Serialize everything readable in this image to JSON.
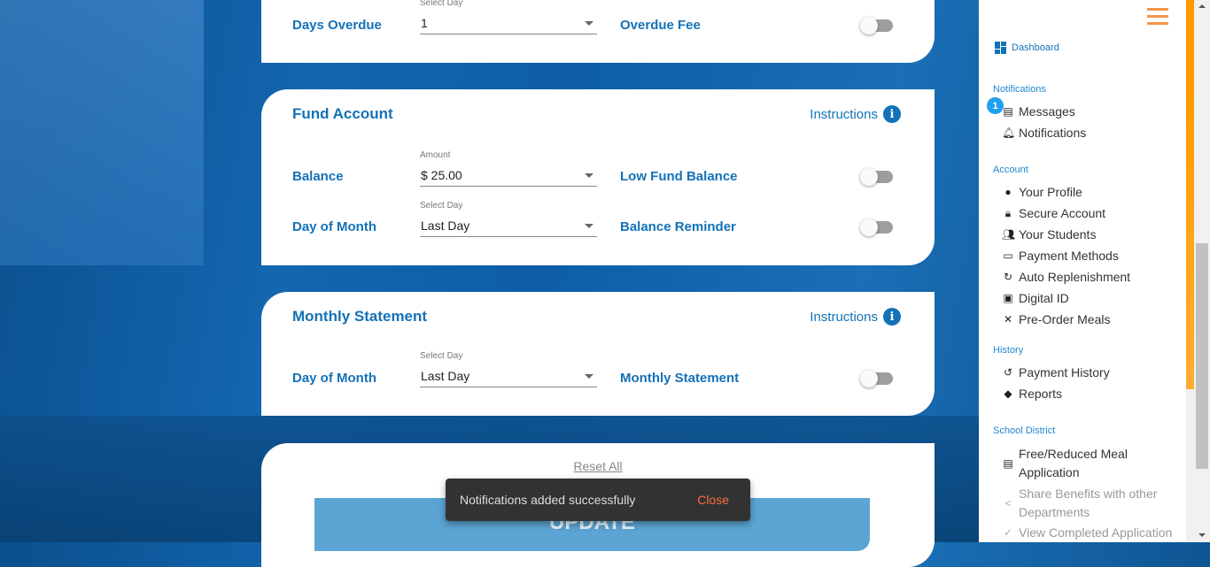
{
  "overdue": {
    "label": "Days Overdue",
    "select_caption": "Select Day",
    "select_value": "1",
    "toggle_label": "Overdue Fee",
    "toggle_on": false
  },
  "fund": {
    "title": "Fund Account",
    "instructions": "Instructions",
    "balance_label": "Balance",
    "amount_caption": "Amount",
    "amount_value": "$ 25.00",
    "low_fund_label": "Low Fund Balance",
    "low_fund_on": false,
    "dom_label": "Day of Month",
    "dom_caption": "Select Day",
    "dom_value": "Last Day",
    "reminder_label": "Balance Reminder",
    "reminder_on": false
  },
  "monthly": {
    "title": "Monthly Statement",
    "instructions": "Instructions",
    "dom_label": "Day of Month",
    "dom_caption": "Select Day",
    "dom_value": "Last Day",
    "toggle_label": "Monthly Statement",
    "toggle_on": false
  },
  "actions": {
    "reset": "Reset All",
    "update": "UPDATE"
  },
  "toast": {
    "message": "Notifications added successfully",
    "close": "Close"
  },
  "sidebar": {
    "dashboard": "Dashboard",
    "notifications_header": "Notifications",
    "messages": "Messages",
    "messages_badge": "1",
    "notifications": "Notifications",
    "account_header": "Account",
    "account": [
      "Your Profile",
      "Secure Account",
      "Your Students",
      "Payment Methods",
      "Auto Replenishment",
      "Digital ID",
      "Pre-Order Meals"
    ],
    "history_header": "History",
    "history": [
      "Payment History",
      "Reports"
    ],
    "district_header": "School District",
    "frl_1": "Free/Reduced Meal",
    "frl_2": "Application",
    "share_1": "Share Benefits with other",
    "share_2": "Departments",
    "view_completed": "View Completed Application"
  }
}
